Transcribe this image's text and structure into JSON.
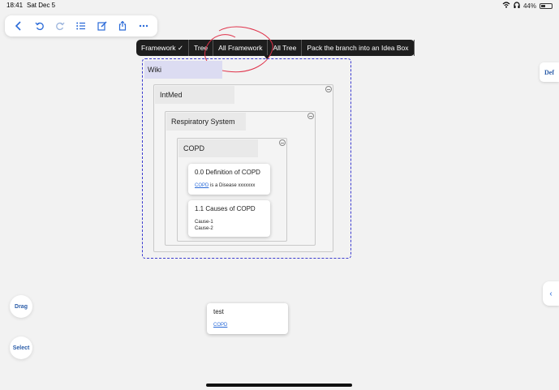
{
  "status": {
    "time": "18:41",
    "date": "Sat Dec 5",
    "battery": "44%"
  },
  "toolbar": {
    "icons": [
      "back-icon",
      "undo-icon",
      "redo-icon",
      "list-icon",
      "edit-icon",
      "share-icon",
      "more-icon"
    ]
  },
  "context_menu": {
    "items": [
      "Framework ✓",
      "Tree",
      "All Framework",
      "All Tree",
      "Pack the branch into an Idea Box"
    ]
  },
  "mindmap": {
    "wiki": "Wiki",
    "intmed": "IntMed",
    "respiratory": "Respiratory System",
    "copd": "COPD",
    "card1": {
      "title": "0.0 Definition of COPD",
      "link": "COPD",
      "text": " is a Disease xxxxxxx"
    },
    "card2": {
      "title": "1.1 Causes of COPD",
      "line1": "Cause-1",
      "line2": "Cause-2"
    }
  },
  "floating_card": {
    "title": "test",
    "link": "COPD"
  },
  "side": {
    "def_label": "Def",
    "chevron": "‹"
  },
  "buttons": {
    "drag": "Drag",
    "select": "Select"
  },
  "colors": {
    "accent": "#2a6ad8",
    "selection_border": "#3b3bd0",
    "annotation": "#e0324a"
  }
}
